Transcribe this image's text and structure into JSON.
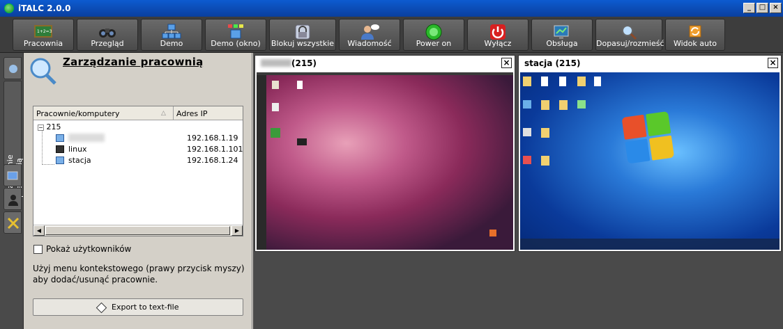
{
  "window": {
    "title": "iTALC 2.0.0",
    "min": "_",
    "max": "□",
    "close": "×"
  },
  "toolbar": [
    {
      "label": "Pracownia",
      "icon": "classroom-board-icon"
    },
    {
      "label": "Przegląd",
      "icon": "binoculars-icon"
    },
    {
      "label": "Demo",
      "icon": "demo-network-icon"
    },
    {
      "label": "Demo (okno)",
      "icon": "demo-window-icon"
    },
    {
      "label": "Blokuj wszystkie",
      "icon": "lock-icon"
    },
    {
      "label": "Wiadomość",
      "icon": "message-user-icon"
    },
    {
      "label": "Power on",
      "icon": "power-on-icon"
    },
    {
      "label": "Wyłącz",
      "icon": "power-off-icon"
    },
    {
      "label": "Obsługa",
      "icon": "remote-control-icon"
    },
    {
      "label": "Dopasuj/rozmieść",
      "icon": "magnifier-icon"
    },
    {
      "label": "Widok auto",
      "icon": "auto-view-icon"
    }
  ],
  "sidebar": {
    "active_tab": "Zarządzanie pracownią"
  },
  "panel": {
    "title": "Zarządzanie pracownią",
    "columns": [
      "Pracownie/komputery",
      "Adres IP"
    ],
    "group": "215",
    "computers": [
      {
        "name": "",
        "ip": "192.168.1.19"
      },
      {
        "name": "linux",
        "ip": "192.168.1.101"
      },
      {
        "name": "stacja",
        "ip": "192.168.1.24"
      }
    ],
    "show_users_label": "Pokaż użytkowników",
    "hint": "Użyj menu kontekstowego (prawy przycisk myszy) aby dodać/usunąć pracownie.",
    "export_label": "Export to text-file"
  },
  "screens": [
    {
      "title": "(215)",
      "close": "×"
    },
    {
      "title": "stacja (215)",
      "close": "×"
    }
  ]
}
